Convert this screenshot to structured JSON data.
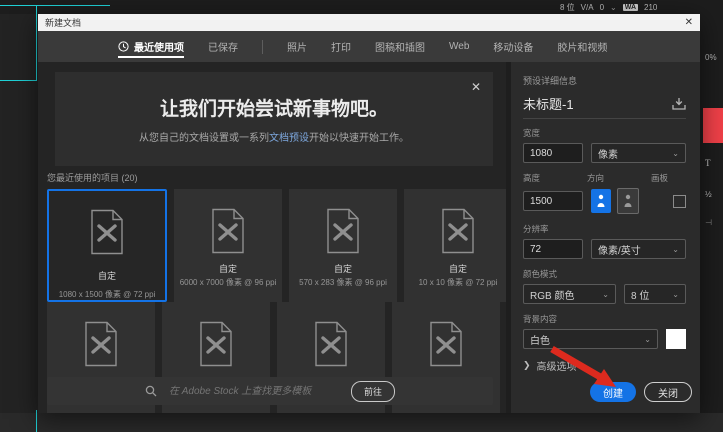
{
  "chrome": {
    "char_panel": {
      "bit": "8 位",
      "va": "V/A",
      "va_value": "0",
      "wa": "WA",
      "wa_value": "210",
      "chevron": "⌄",
      "percent": "0%",
      "t_glyph": "T",
      "half_glyph": "½",
      "tab_glyph": "⊣"
    }
  },
  "dialog": {
    "title": "新建文档",
    "close_icon": "✕",
    "tabs": [
      {
        "label": "最近使用项",
        "active": true
      },
      {
        "label": "已保存",
        "active": false
      },
      {
        "label": "照片",
        "active": false
      },
      {
        "label": "打印",
        "active": false
      },
      {
        "label": "图稿和插图",
        "active": false
      },
      {
        "label": "Web",
        "active": false
      },
      {
        "label": "移动设备",
        "active": false
      },
      {
        "label": "胶片和视频",
        "active": false
      }
    ],
    "banner": {
      "heading": "让我们开始尝试新事物吧。",
      "sub_before": "从您自己的文档设置或一系列",
      "sub_link": "文档预设",
      "sub_after": "开始以快速开始工作。",
      "close_icon": "✕"
    },
    "recent_label": "您最近使用的项目",
    "recent_count": "(20)",
    "cards": [
      {
        "title": "自定",
        "dims": "1080 x 1500 像素 @ 72 ppi",
        "selected": true
      },
      {
        "title": "自定",
        "dims": "6000 x 7000 像素 @ 96 ppi",
        "selected": false
      },
      {
        "title": "自定",
        "dims": "570 x 283 像素 @ 96 ppi",
        "selected": false
      },
      {
        "title": "自定",
        "dims": "10 x 10 像素 @ 72 ppi",
        "selected": false
      }
    ],
    "search": {
      "placeholder": "在 Adobe Stock 上查找更多模板",
      "go_label": "前往"
    },
    "preset": {
      "header": "预设详细信息",
      "doc_name": "未标题-1",
      "width_label": "宽度",
      "width_value": "1080",
      "width_unit": "像素",
      "height_label": "高度",
      "height_value": "1500",
      "orientation_label": "方向",
      "artboard_label": "画板",
      "resolution_label": "分辨率",
      "resolution_value": "72",
      "resolution_unit": "像素/英寸",
      "color_mode_label": "颜色模式",
      "color_mode_value": "RGB 颜色",
      "bit_depth_value": "8 位",
      "background_label": "背景内容",
      "background_value": "白色",
      "advanced_label": "高级选项",
      "create_label": "创建",
      "close_label": "关闭",
      "chevron": "⌄"
    }
  },
  "colors": {
    "accent_blue": "#1473e6",
    "guide_cyan": "#1fd1d6",
    "annotation_red": "#dd2a1e",
    "char_panel_red": "#ef4048",
    "background_swatch": "#ffffff",
    "titlebar": "#f2f2f2"
  }
}
